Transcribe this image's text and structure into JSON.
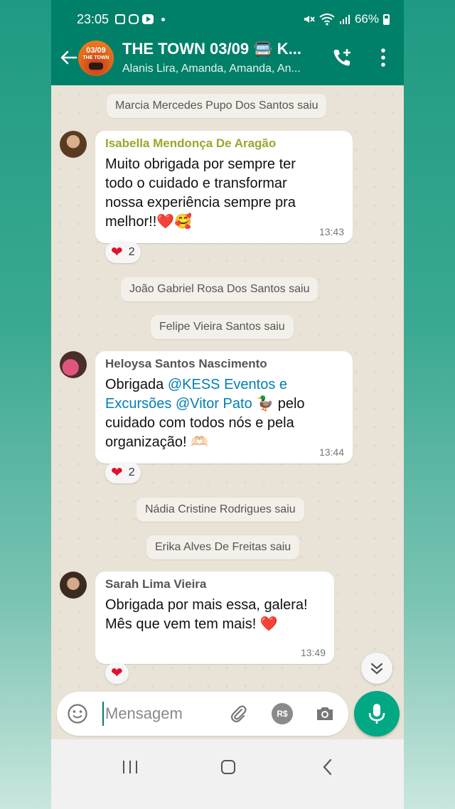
{
  "status_bar": {
    "time": "23:05",
    "battery": "66%"
  },
  "header": {
    "title": "THE TOWN 03/09 🚍 K...",
    "subtitle": "Alanis Lira, Amanda, Amanda, An...",
    "avatar_text_top": "03/09",
    "avatar_text_bottom": "THE TOWN"
  },
  "chat": {
    "system_1": "Marcia Mercedes Pupo Dos Santos saiu",
    "messages": [
      {
        "sender": "Isabella Mendonça De Aragão",
        "sender_color": "#9aa62b",
        "line1": "Muito obrigada por sempre ter",
        "line2": "todo o cuidado e transformar",
        "line3": "nossa experiência sempre pra",
        "line4": "melhor!!❤️🥰",
        "time": "13:43",
        "reaction": "❤",
        "reaction_count": "2"
      },
      {
        "sender": "Heloysa Santos Nascimento",
        "sender_color": "#555555",
        "line1_pre": "Obrigada ",
        "mention1": "@KESS Eventos e",
        "mention1b": "Excursões",
        "mention2": "@Vitor Pato",
        "line2_post": " 🦆 pelo",
        "line3": "cuidado com todos nós e pela",
        "line4": "organização! 🫶🏻",
        "time": "13:44",
        "reaction": "❤",
        "reaction_count": "2"
      },
      {
        "sender": "Sarah Lima Vieira",
        "sender_color": "#555555",
        "line1": "Obrigada por mais essa, galera!",
        "line2": "Mês que vem tem mais! ❤️",
        "time": "13:49",
        "reaction": "❤"
      }
    ],
    "system_2": "João Gabriel Rosa Dos Santos saiu",
    "system_3": "Felipe Vieira Santos saiu",
    "system_4": "Nádia Cristine Rodrigues saiu",
    "system_5": "Erika Alves De Freitas saiu"
  },
  "composer": {
    "placeholder": "Mensagem",
    "currency_label": "R$"
  },
  "colors": {
    "header": "#008069",
    "accent": "#00a884",
    "heart": "#e0102b"
  }
}
